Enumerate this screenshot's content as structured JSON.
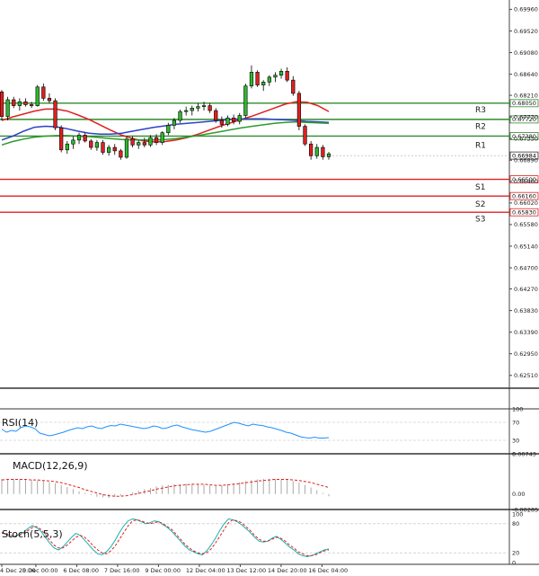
{
  "chart_data": {
    "type": "candlestick",
    "symbol": "",
    "price_axis": {
      "ylim": [
        0.6225,
        0.7015
      ],
      "ticks": [
        "0.69960",
        "0.69520",
        "0.69080",
        "0.68640",
        "0.68210",
        "0.67770",
        "0.67330",
        "0.66890",
        "0.66460",
        "0.66020",
        "0.65580",
        "0.65140",
        "0.64700",
        "0.64270",
        "0.63830",
        "0.63390",
        "0.62950",
        "0.62510"
      ],
      "current_price": "0.66984"
    },
    "x_axis": {
      "labels": [
        "4 Dec 20:00",
        "5 Dec 00:00",
        "6 Dec 08:00",
        "7 Dec 16:00",
        "9 Dec 00:00",
        "12 Dec 04:00",
        "13 Dec 12:00",
        "14 Dec 20:00",
        "16 Dec 04:00"
      ],
      "label_bar_index": [
        0,
        10,
        22,
        34,
        46,
        58,
        70,
        82,
        94
      ]
    },
    "levels": [
      {
        "name": "R3",
        "value": 0.6805,
        "value_label": "0.68050",
        "color": "#2e8b2e"
      },
      {
        "name": "R2",
        "value": 0.6772,
        "value_label": "0.67720",
        "color": "#2e8b2e"
      },
      {
        "name": "R1",
        "value": 0.6738,
        "value_label": "0.67380",
        "color": "#2e8b2e"
      },
      {
        "name": "S1",
        "value": 0.665,
        "value_label": "0.66500",
        "color": "#e02020"
      },
      {
        "name": "S2",
        "value": 0.6616,
        "value_label": "0.66160",
        "color": "#e02020"
      },
      {
        "name": "S3",
        "value": 0.6583,
        "value_label": "0.65830",
        "color": "#e02020"
      }
    ],
    "level_label_positions": {
      "R3": 0.6792,
      "R2": 0.6758,
      "R1": 0.672,
      "S1": 0.6635,
      "S2": 0.66,
      "S3": 0.657
    },
    "candles": [
      [
        0.6828,
        0.6832,
        0.677,
        0.6778
      ],
      [
        0.6778,
        0.6818,
        0.677,
        0.6812
      ],
      [
        0.6812,
        0.6818,
        0.6795,
        0.68
      ],
      [
        0.68,
        0.6815,
        0.679,
        0.6808
      ],
      [
        0.6808,
        0.6815,
        0.6798,
        0.6802
      ],
      [
        0.6802,
        0.6808,
        0.6795,
        0.68
      ],
      [
        0.68,
        0.6842,
        0.6798,
        0.6838
      ],
      [
        0.6838,
        0.6845,
        0.681,
        0.6815
      ],
      [
        0.6815,
        0.6825,
        0.6805,
        0.681
      ],
      [
        0.681,
        0.6815,
        0.675,
        0.6755
      ],
      [
        0.6755,
        0.676,
        0.6705,
        0.671
      ],
      [
        0.671,
        0.6728,
        0.6702,
        0.6722
      ],
      [
        0.6722,
        0.6738,
        0.6712,
        0.673
      ],
      [
        0.673,
        0.6745,
        0.6722,
        0.674
      ],
      [
        0.674,
        0.6745,
        0.6725,
        0.6728
      ],
      [
        0.6728,
        0.6732,
        0.671,
        0.6715
      ],
      [
        0.6715,
        0.673,
        0.6708,
        0.6725
      ],
      [
        0.6725,
        0.673,
        0.67,
        0.6705
      ],
      [
        0.6705,
        0.672,
        0.6698,
        0.6715
      ],
      [
        0.6715,
        0.6722,
        0.67,
        0.6708
      ],
      [
        0.6708,
        0.6712,
        0.669,
        0.6695
      ],
      [
        0.6695,
        0.6738,
        0.6692,
        0.6732
      ],
      [
        0.6732,
        0.6738,
        0.6715,
        0.672
      ],
      [
        0.672,
        0.673,
        0.6712,
        0.6725
      ],
      [
        0.6725,
        0.6735,
        0.6715,
        0.672
      ],
      [
        0.672,
        0.674,
        0.6716,
        0.6735
      ],
      [
        0.6735,
        0.6742,
        0.672,
        0.6725
      ],
      [
        0.6725,
        0.6748,
        0.672,
        0.6745
      ],
      [
        0.6745,
        0.6765,
        0.674,
        0.676
      ],
      [
        0.676,
        0.6775,
        0.6752,
        0.677
      ],
      [
        0.677,
        0.6792,
        0.6765,
        0.6788
      ],
      [
        0.6788,
        0.6798,
        0.678,
        0.679
      ],
      [
        0.679,
        0.68,
        0.678,
        0.6795
      ],
      [
        0.6795,
        0.6805,
        0.6788,
        0.6798
      ],
      [
        0.6798,
        0.6808,
        0.679,
        0.68
      ],
      [
        0.68,
        0.6805,
        0.6785,
        0.679
      ],
      [
        0.679,
        0.6795,
        0.6765,
        0.677
      ],
      [
        0.677,
        0.6778,
        0.6755,
        0.6762
      ],
      [
        0.6762,
        0.678,
        0.6758,
        0.6775
      ],
      [
        0.6775,
        0.6782,
        0.6762,
        0.6768
      ],
      [
        0.6768,
        0.6785,
        0.6762,
        0.678
      ],
      [
        0.678,
        0.6845,
        0.6775,
        0.684
      ],
      [
        0.684,
        0.6882,
        0.6835,
        0.6868
      ],
      [
        0.6868,
        0.6872,
        0.6838,
        0.6842
      ],
      [
        0.6842,
        0.6852,
        0.683,
        0.6848
      ],
      [
        0.6848,
        0.6862,
        0.684,
        0.6858
      ],
      [
        0.6858,
        0.6868,
        0.6848,
        0.6862
      ],
      [
        0.6862,
        0.6875,
        0.6855,
        0.687
      ],
      [
        0.687,
        0.6878,
        0.6848,
        0.6852
      ],
      [
        0.6852,
        0.686,
        0.682,
        0.6825
      ],
      [
        0.6825,
        0.683,
        0.675,
        0.6758
      ],
      [
        0.6758,
        0.6762,
        0.6718,
        0.6722
      ],
      [
        0.6722,
        0.6728,
        0.669,
        0.6698
      ],
      [
        0.6698,
        0.6722,
        0.6692,
        0.6715
      ],
      [
        0.6715,
        0.672,
        0.669,
        0.6696
      ],
      [
        0.6696,
        0.6706,
        0.669,
        0.6702
      ]
    ],
    "moving_averages": [
      {
        "color": "#e02020",
        "values": [
          0.677,
          0.6777,
          0.6783,
          0.6789,
          0.6793,
          0.6793,
          0.6789,
          0.6781,
          0.6772,
          0.6761,
          0.675,
          0.674,
          0.6733,
          0.6728,
          0.6726,
          0.6727,
          0.673,
          0.6735,
          0.6742,
          0.675,
          0.6758,
          0.6765,
          0.6772,
          0.6779,
          0.6787,
          0.6795,
          0.6803,
          0.6808,
          0.6807,
          0.68,
          0.6788
        ]
      },
      {
        "color": "#2e40c8",
        "values": [
          0.673,
          0.6738,
          0.6748,
          0.6756,
          0.6758,
          0.6757,
          0.6753,
          0.6748,
          0.6744,
          0.6742,
          0.6742,
          0.6744,
          0.6748,
          0.6752,
          0.6756,
          0.6759,
          0.6762,
          0.6764,
          0.6766,
          0.6768,
          0.677,
          0.6772,
          0.6773,
          0.6773,
          0.6773,
          0.6772,
          0.6771,
          0.677,
          0.6768,
          0.6767,
          0.6766
        ]
      },
      {
        "color": "#2e9a2e",
        "values": [
          0.672,
          0.6727,
          0.6732,
          0.6736,
          0.6738,
          0.6739,
          0.6739,
          0.6738,
          0.6737,
          0.6735,
          0.6733,
          0.6731,
          0.673,
          0.673,
          0.673,
          0.6731,
          0.6733,
          0.6736,
          0.6739,
          0.6743,
          0.6747,
          0.6751,
          0.6755,
          0.6758,
          0.6761,
          0.6764,
          0.6766,
          0.6767,
          0.6766,
          0.6765,
          0.6764
        ]
      }
    ],
    "rsi": {
      "title": "RSI(14)",
      "levels": [
        "100",
        "70",
        "30",
        "0"
      ],
      "color": "#1e90ff",
      "values": [
        55,
        48,
        52,
        50,
        58,
        62,
        60,
        56,
        46,
        43,
        40,
        42,
        45,
        48,
        52,
        55,
        58,
        56,
        60,
        62,
        58,
        56,
        60,
        63,
        62,
        66,
        64,
        62,
        60,
        58,
        56,
        58,
        62,
        60,
        56,
        58,
        62,
        64,
        60,
        57,
        54,
        52,
        50,
        48,
        50,
        54,
        58,
        62,
        66,
        70,
        68,
        65,
        62,
        66,
        64,
        63,
        60,
        58,
        55,
        52,
        48,
        46,
        42,
        38,
        36,
        35,
        37,
        35,
        35,
        36
      ]
    },
    "macd": {
      "title": "MACD(12,26,9)",
      "ticks": [
        "0.00743",
        "0.00",
        "-0.002857"
      ],
      "hist_color": "#a8a8a8",
      "signal_color": "#e02020",
      "hist": [
        0.0028,
        0.0028,
        0.0028,
        0.0027,
        0.0026,
        0.0026,
        0.0025,
        0.0024,
        0.0022,
        0.002,
        0.0017,
        0.0013,
        0.0009,
        0.0005,
        0.0002,
        -0.0002,
        -0.0005,
        -0.0006,
        -0.0007,
        -0.0005,
        -0.0003,
        0.0,
        0.0003,
        0.0006,
        0.0009,
        0.0011,
        0.0014,
        0.0016,
        0.0017,
        0.0018,
        0.0018,
        0.0019,
        0.0019,
        0.0018,
        0.0017,
        0.0016,
        0.0015,
        0.0016,
        0.0018,
        0.002,
        0.0022,
        0.0024,
        0.0026,
        0.0027,
        0.0028,
        0.0028,
        0.0028,
        0.0027,
        0.0026,
        0.0024,
        0.0021,
        0.0017,
        0.0012,
        0.0007,
        0.0002,
        -0.0004
      ],
      "signal": [
        0.0026,
        0.0027,
        0.0027,
        0.0027,
        0.0027,
        0.0026,
        0.0026,
        0.0025,
        0.0024,
        0.0023,
        0.0021,
        0.0018,
        0.0015,
        0.0012,
        0.0008,
        0.0005,
        0.0002,
        -0.0001,
        -0.0003,
        -0.0004,
        -0.0004,
        -0.0003,
        -0.0001,
        0.0001,
        0.0004,
        0.0006,
        0.0009,
        0.0011,
        0.0013,
        0.0015,
        0.0016,
        0.0017,
        0.0018,
        0.0018,
        0.0018,
        0.0017,
        0.0016,
        0.0016,
        0.0017,
        0.0018,
        0.0019,
        0.0021,
        0.0022,
        0.0024,
        0.0025,
        0.0026,
        0.0027,
        0.0027,
        0.0027,
        0.0026,
        0.0025,
        0.0023,
        0.0021,
        0.0018,
        0.0015,
        0.0012
      ]
    },
    "stoch": {
      "title": "Stoch(5,5,3)",
      "ticks": [
        "100",
        "80",
        "20",
        "0"
      ],
      "main_color": "#1ab0b0",
      "signal_color": "#e02020",
      "main": [
        62,
        58,
        52,
        54,
        58,
        62,
        70,
        76,
        72,
        64,
        52,
        40,
        30,
        26,
        32,
        42,
        52,
        60,
        56,
        46,
        36,
        26,
        18,
        16,
        22,
        32,
        46,
        62,
        76,
        86,
        90,
        88,
        84,
        80,
        82,
        86,
        84,
        78,
        72,
        64,
        54,
        44,
        34,
        26,
        22,
        18,
        16,
        24,
        36,
        50,
        66,
        80,
        90,
        88,
        84,
        78,
        70,
        62,
        52,
        44,
        42,
        44,
        50,
        54,
        48,
        40,
        32,
        26,
        18,
        14,
        12,
        14,
        18,
        22,
        26,
        28
      ],
      "signal": [
        60,
        60,
        56,
        54,
        56,
        60,
        66,
        72,
        74,
        68,
        58,
        46,
        36,
        30,
        30,
        36,
        44,
        52,
        56,
        52,
        44,
        34,
        26,
        20,
        18,
        24,
        34,
        48,
        62,
        76,
        86,
        88,
        86,
        82,
        80,
        82,
        84,
        80,
        74,
        68,
        58,
        48,
        38,
        30,
        24,
        20,
        18,
        20,
        28,
        40,
        54,
        68,
        82,
        88,
        86,
        82,
        74,
        66,
        56,
        48,
        44,
        44,
        48,
        52,
        50,
        44,
        36,
        30,
        22,
        18,
        14,
        14,
        16,
        20,
        24,
        26
      ]
    }
  }
}
